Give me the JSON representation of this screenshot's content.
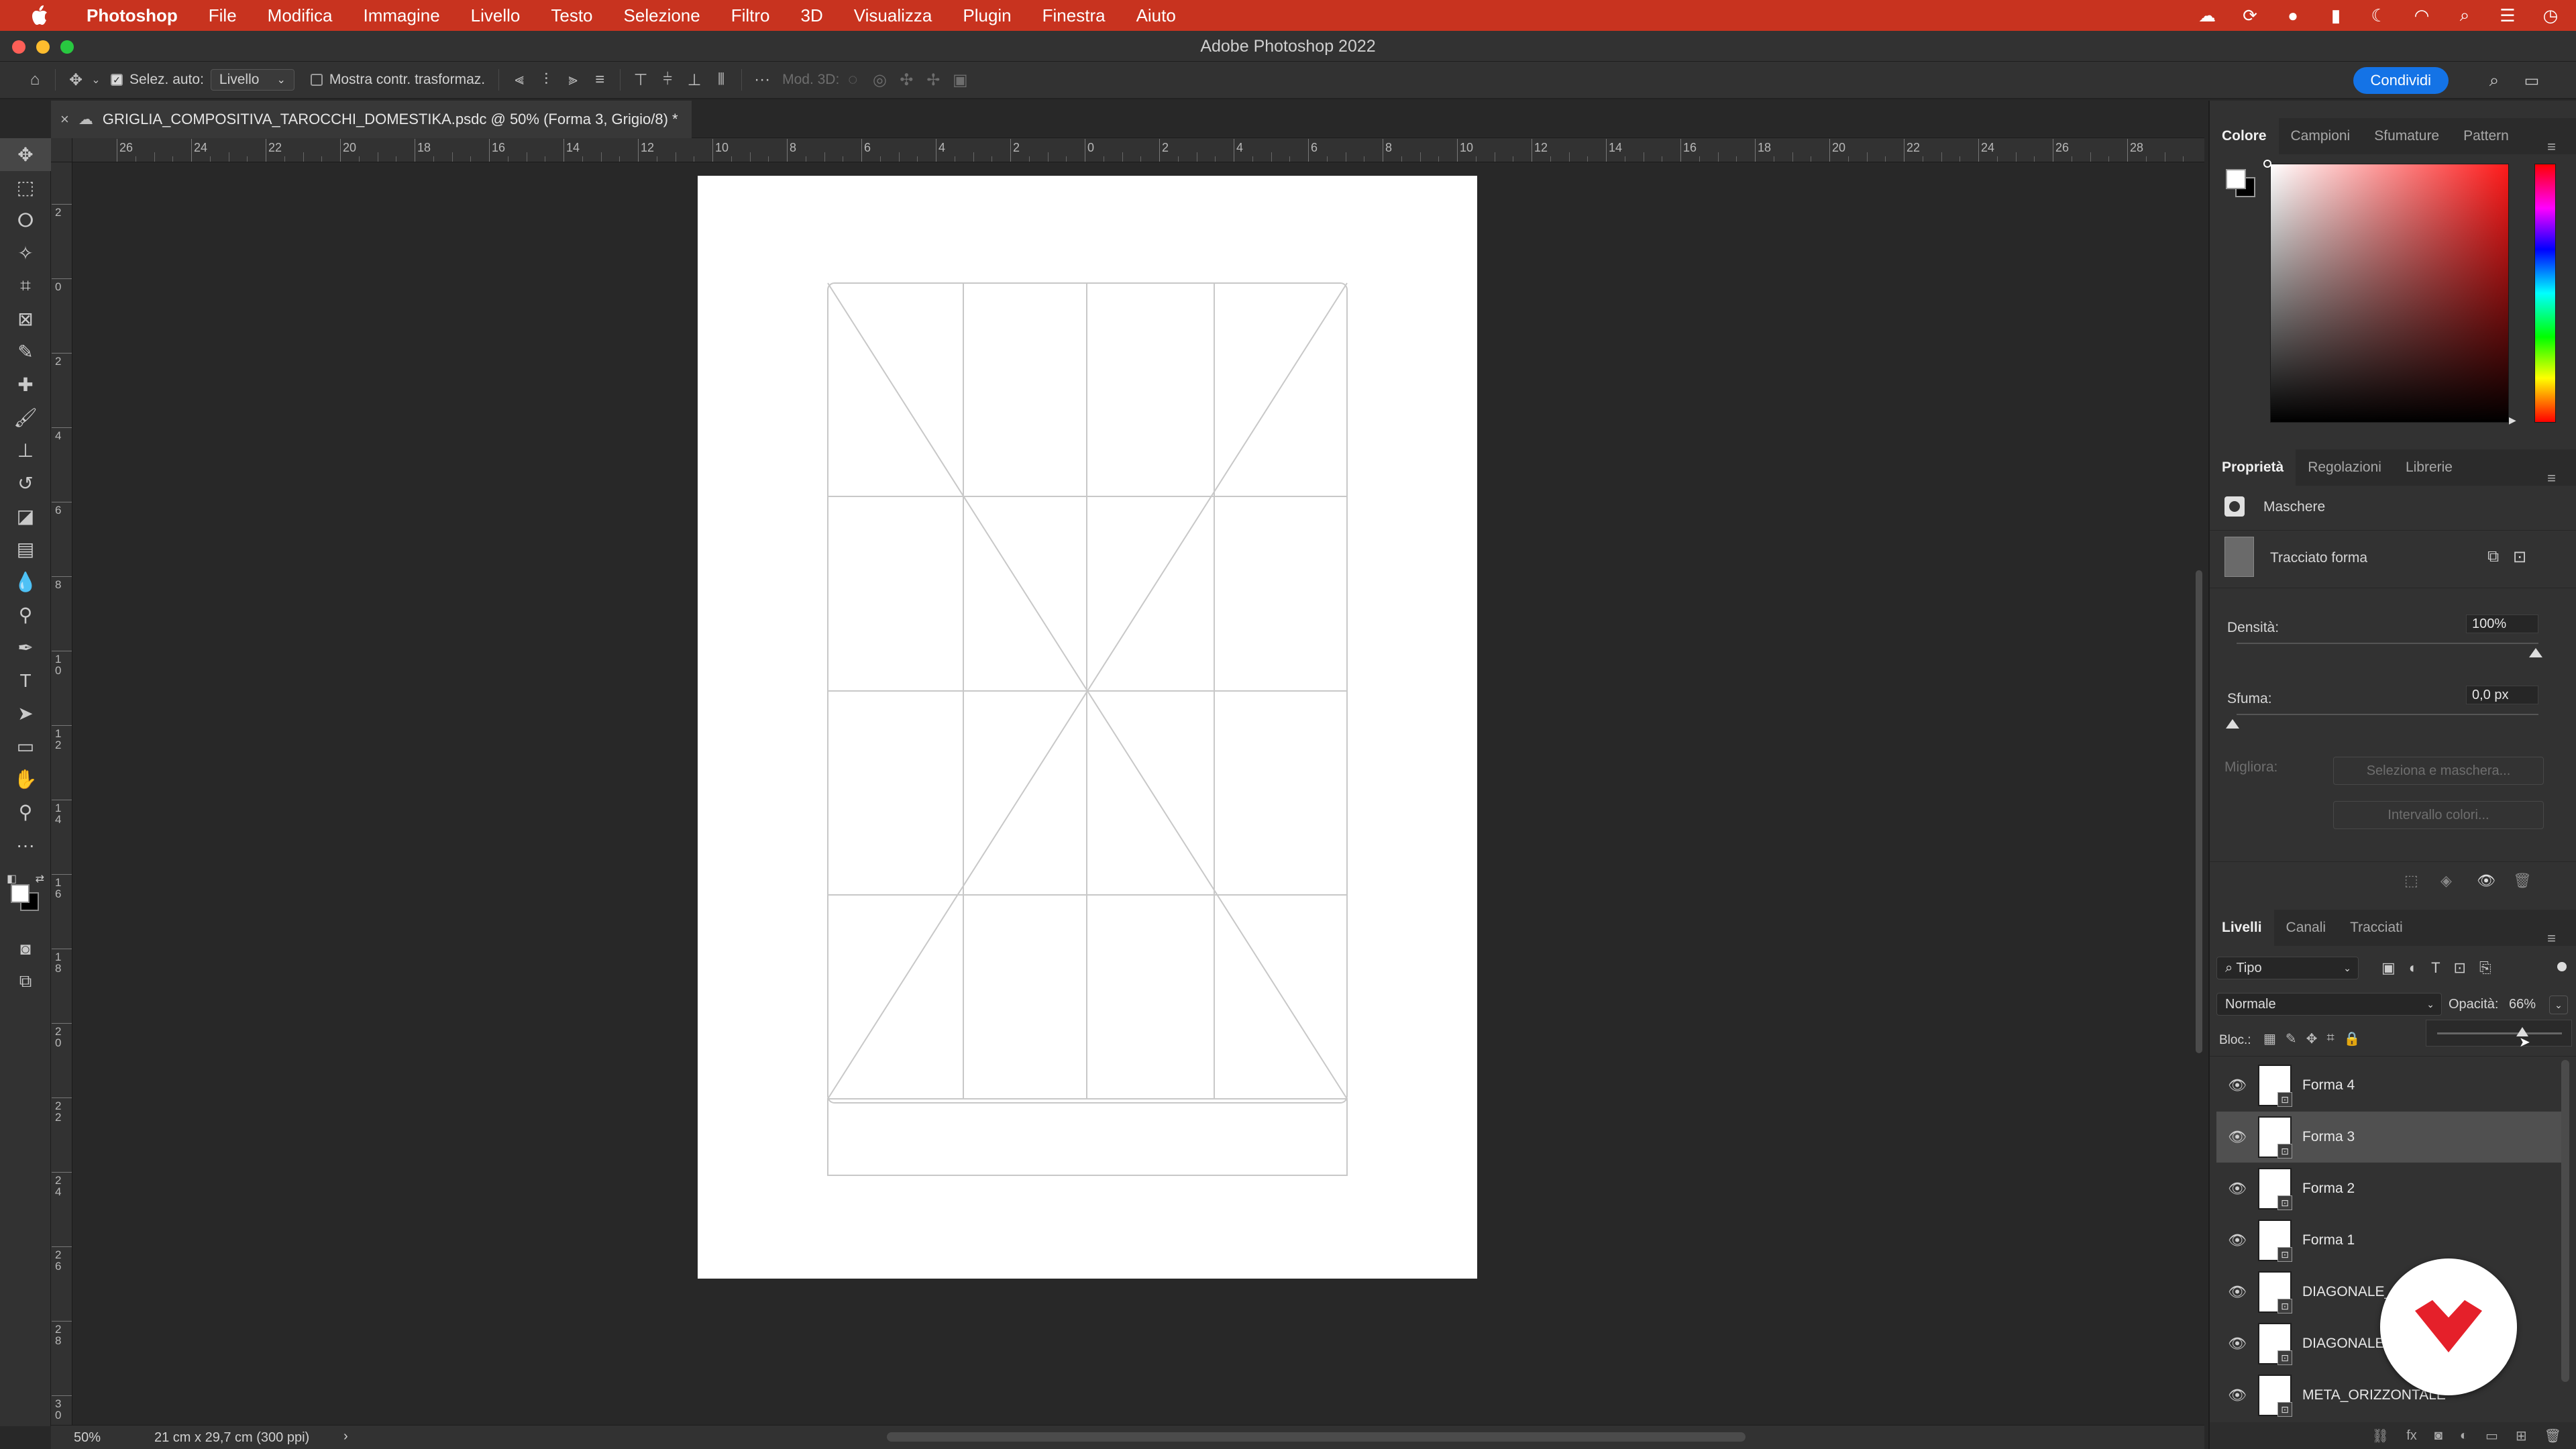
{
  "macbar": {
    "apple_icon": "apple-icon",
    "menus": [
      "Photoshop",
      "File",
      "Modifica",
      "Immagine",
      "Livello",
      "Testo",
      "Selezione",
      "Filtro",
      "3D",
      "Visualizza",
      "Plugin",
      "Finestra",
      "Aiuto"
    ],
    "status_icons": [
      "creative-cloud-icon",
      "cc-sync-icon",
      "notification-icon",
      "flag-icon",
      "moon-icon",
      "wifi-icon",
      "search-icon",
      "control-center-icon",
      "clock-icon"
    ]
  },
  "window": {
    "title": "Adobe Photoshop 2022"
  },
  "options": {
    "auto_select_label": "Selez. auto:",
    "auto_select_value": "Livello",
    "transform_label": "Mostra contr. trasformaz.",
    "mode3d_label": "Mod. 3D:",
    "share_label": "Condividi"
  },
  "document": {
    "tab_title": "GRIGLIA_COMPOSITIVA_TAROCCHI_DOMESTIKA.psdc @ 50% (Forma 3, Grigio/8) *"
  },
  "tools": [
    {
      "name": "move-tool",
      "glyph": "✥"
    },
    {
      "name": "marquee-tool",
      "glyph": "⬚"
    },
    {
      "name": "lasso-tool",
      "glyph": "ⵔ"
    },
    {
      "name": "magic-wand-tool",
      "glyph": "✧"
    },
    {
      "name": "crop-tool",
      "glyph": "⌗"
    },
    {
      "name": "frame-tool",
      "glyph": "⊠"
    },
    {
      "name": "eyedropper-tool",
      "glyph": "✎"
    },
    {
      "name": "healing-brush-tool",
      "glyph": "✚"
    },
    {
      "name": "brush-tool",
      "glyph": "🖌"
    },
    {
      "name": "stamp-tool",
      "glyph": "⊥"
    },
    {
      "name": "history-brush-tool",
      "glyph": "↺"
    },
    {
      "name": "eraser-tool",
      "glyph": "◪"
    },
    {
      "name": "gradient-tool",
      "glyph": "▤"
    },
    {
      "name": "blur-tool",
      "glyph": "💧"
    },
    {
      "name": "dodge-tool",
      "glyph": "⚲"
    },
    {
      "name": "pen-tool",
      "glyph": "✒"
    },
    {
      "name": "type-tool",
      "glyph": "T"
    },
    {
      "name": "path-selection-tool",
      "glyph": "➤"
    },
    {
      "name": "rectangle-tool",
      "glyph": "▭"
    },
    {
      "name": "hand-tool",
      "glyph": "✋"
    },
    {
      "name": "zoom-tool",
      "glyph": "⚲"
    },
    {
      "name": "more-tools",
      "glyph": "···"
    }
  ],
  "ruler_top": [
    "26",
    "24",
    "22",
    "20",
    "18",
    "16",
    "14",
    "12",
    "10",
    "8",
    "6",
    "4",
    "2",
    "0",
    "2",
    "4",
    "6",
    "8",
    "10",
    "12",
    "14",
    "16",
    "18",
    "20",
    "22",
    "24",
    "26",
    "28"
  ],
  "ruler_left": [
    "2",
    "0",
    "2",
    "4",
    "6",
    "8",
    "10",
    "12",
    "14",
    "16",
    "18",
    "20",
    "22",
    "24",
    "26",
    "28",
    "30"
  ],
  "status": {
    "zoom": "50%",
    "doc_size": "21 cm x 29,7 cm (300 ppi)",
    "arrow": "›"
  },
  "color_panel": {
    "tabs": [
      "Colore",
      "Campioni",
      "Sfumature",
      "Pattern"
    ],
    "hue_color": "#ff1a1a"
  },
  "properties_panel": {
    "tabs": [
      "Proprietà",
      "Regolazioni",
      "Librerie"
    ],
    "section": "Maschere",
    "mask_label": "Tracciato forma",
    "density_label": "Densità:",
    "density_value": "100%",
    "feather_label": "Sfuma:",
    "feather_value": "0,0 px",
    "refine_label": "Migliora:",
    "select_mask_button": "Seleziona e maschera...",
    "color_range_button": "Intervallo colori..."
  },
  "layers_panel": {
    "tabs": [
      "Livelli",
      "Canali",
      "Tracciati"
    ],
    "filter_label": "Tipo",
    "blend_mode": "Normale",
    "opacity_label": "Opacità:",
    "opacity_value": "66%",
    "lock_label": "Bloc.:",
    "layers": [
      {
        "name": "Forma 4",
        "selected": false
      },
      {
        "name": "Forma 3",
        "selected": true
      },
      {
        "name": "Forma 2",
        "selected": false
      },
      {
        "name": "Forma 1",
        "selected": false
      },
      {
        "name": "DIAGONALE_2",
        "selected": false
      },
      {
        "name": "DIAGONALE_1",
        "selected": false
      },
      {
        "name": "META_ORIZZONTALE",
        "selected": false
      }
    ]
  },
  "badge": {
    "brand_color": "#e5202a"
  }
}
